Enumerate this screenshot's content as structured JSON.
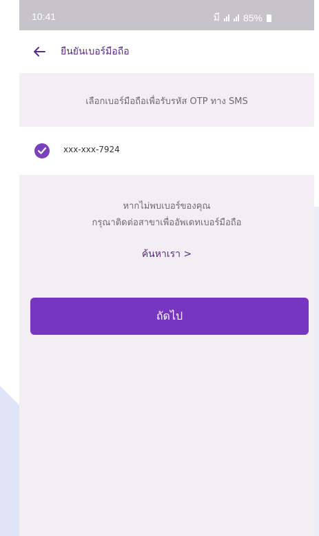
{
  "status_bar": {
    "time": "10:41",
    "network": "มี",
    "battery": "85%"
  },
  "header": {
    "title": "ยืนยันเบอร์มือถือ"
  },
  "otp_caption": "เลือกเบอร์มือถือเพื่อรับรหัส OTP ทาง SMS",
  "phone_option": {
    "number": "xxx-xxx-7924",
    "selected": true
  },
  "not_found": {
    "line1": "หากไม่พบเบอร์ของคุณ",
    "line2": "กรุณาติดต่อสาขาเพื่ออัพเดทเบอร์มือถือ",
    "contact_link": "ค้นหาเรา >"
  },
  "next_button": "ถัดไป",
  "colors": {
    "accent": "#7636c0",
    "accent_text": "#5b2a86",
    "background": "#f2eef4",
    "status_bar": "#c7c3cb"
  },
  "icons": {
    "back": "arrow-left-icon",
    "check": "check-circle-icon"
  }
}
